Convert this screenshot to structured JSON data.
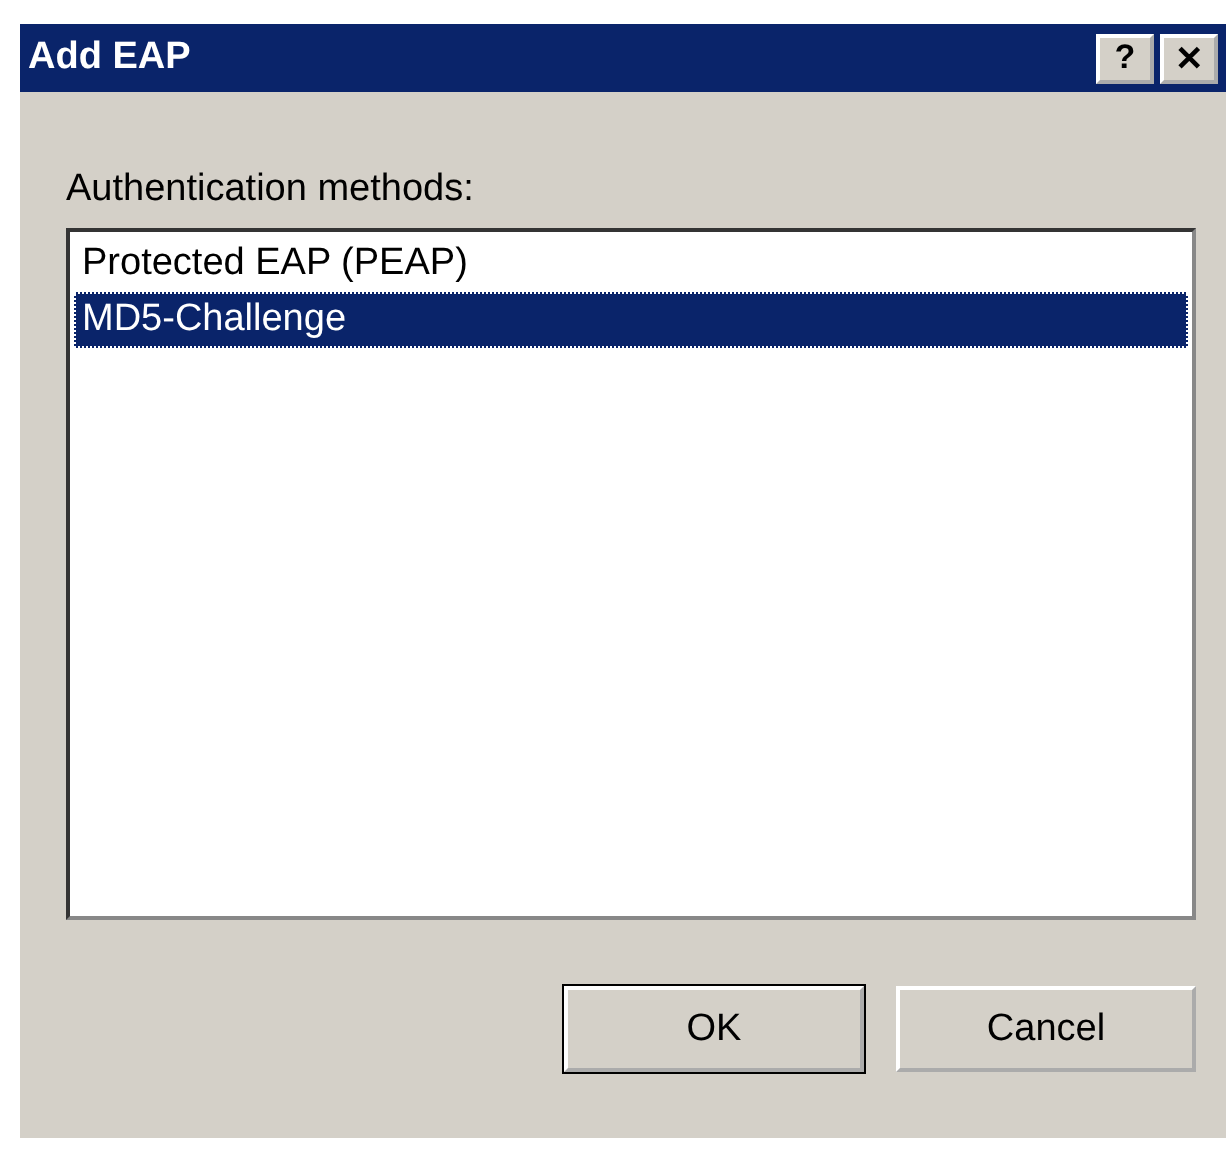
{
  "window": {
    "title": "Add EAP",
    "help_button": "?",
    "close_button": "✕"
  },
  "list_label": "Authentication methods:",
  "methods": [
    {
      "label": "Protected EAP (PEAP)",
      "selected": false
    },
    {
      "label": "MD5-Challenge",
      "selected": true
    }
  ],
  "buttons": [
    {
      "label": "OK",
      "default": true
    },
    {
      "label": "Cancel",
      "default": false
    }
  ]
}
